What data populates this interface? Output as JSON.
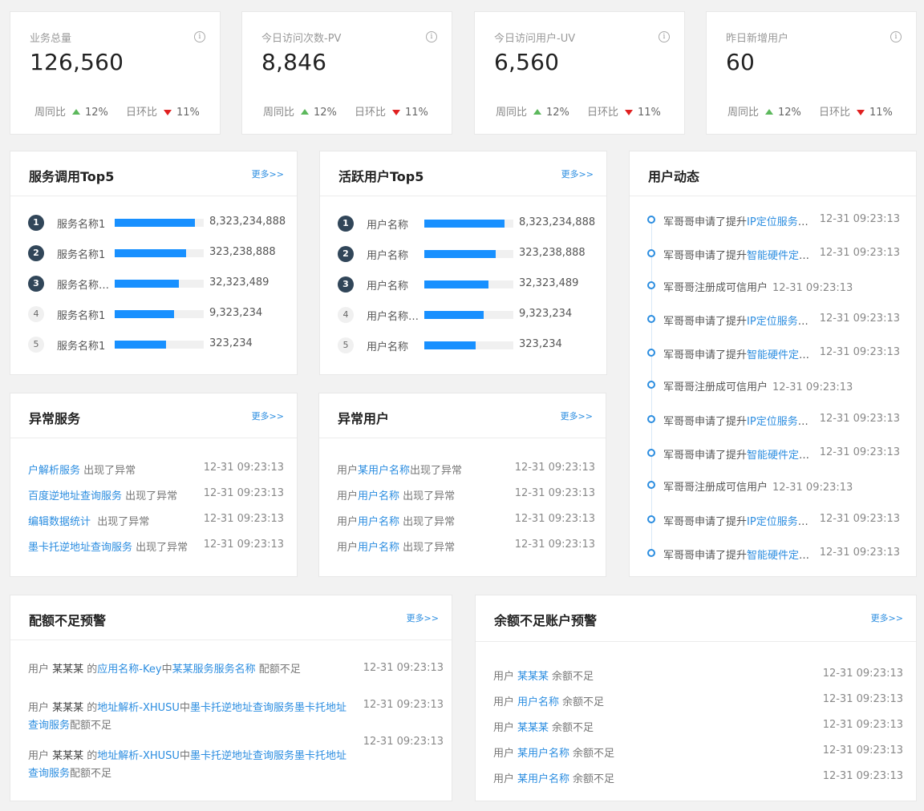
{
  "stats": [
    {
      "title": "业务总量",
      "value": "126,560",
      "week_label": "周同比",
      "week_pct": "12%",
      "day_label": "日环比",
      "day_pct": "11%"
    },
    {
      "title": "今日访问次数-PV",
      "value": "8,846",
      "week_label": "周同比",
      "week_pct": "12%",
      "day_label": "日环比",
      "day_pct": "11%"
    },
    {
      "title": "今日访问用户-UV",
      "value": "6,560",
      "week_label": "周同比",
      "week_pct": "12%",
      "day_label": "日环比",
      "day_pct": "11%"
    },
    {
      "title": "昨日新增用户",
      "value": "60",
      "week_label": "周同比",
      "week_pct": "12%",
      "day_label": "日环比",
      "day_pct": "11%"
    }
  ],
  "info_glyph": "i",
  "more_label": "更多>>",
  "service_top5": {
    "title": "服务调用Top5",
    "items": [
      {
        "rank": "1",
        "name": "服务名称1",
        "value": "8,323,234,888",
        "fill": 0.9
      },
      {
        "rank": "2",
        "name": "服务名称1",
        "value": "323,238,888",
        "fill": 0.8
      },
      {
        "rank": "3",
        "name": "服务名称服务名称",
        "value": "32,323,489",
        "fill": 0.72
      },
      {
        "rank": "4",
        "name": "服务名称1",
        "value": "9,323,234",
        "fill": 0.67
      },
      {
        "rank": "5",
        "name": "服务名称1",
        "value": "323,234",
        "fill": 0.58
      }
    ]
  },
  "user_top5": {
    "title": "活跃用户Top5",
    "items": [
      {
        "rank": "1",
        "name": "用户名称",
        "value": "8,323,234,888",
        "fill": 0.9
      },
      {
        "rank": "2",
        "name": "用户名称",
        "value": "323,238,888",
        "fill": 0.8
      },
      {
        "rank": "3",
        "name": "用户名称",
        "value": "32,323,489",
        "fill": 0.72
      },
      {
        "rank": "4",
        "name": "用户名称用户",
        "value": "9,323,234",
        "fill": 0.67
      },
      {
        "rank": "5",
        "name": "用户名称",
        "value": "323,234",
        "fill": 0.58
      }
    ]
  },
  "user_activity": {
    "title": "用户动态",
    "items": [
      {
        "prefix": "军哥哥申请了提升",
        "link": "IP定位服务服务",
        "time": "12-31 09:23:13"
      },
      {
        "prefix": "军哥哥申请了提升",
        "link": "智能硬件定位服务",
        "time": "12-31 09:23:13"
      },
      {
        "prefix": "军哥哥注册成可信用户",
        "link": "",
        "time": "12-31 09:23:13"
      },
      {
        "prefix": "军哥哥申请了提升",
        "link": "IP定位服务服务",
        "time": "12-31 09:23:13"
      },
      {
        "prefix": "军哥哥申请了提升",
        "link": "智能硬件定位服务",
        "time": "12-31 09:23:13"
      },
      {
        "prefix": "军哥哥注册成可信用户",
        "link": "",
        "time": "12-31 09:23:13"
      },
      {
        "prefix": "军哥哥申请了提升",
        "link": "IP定位服务服务",
        "time": "12-31 09:23:13"
      },
      {
        "prefix": "军哥哥申请了提升",
        "link": "智能硬件定位服务",
        "time": "12-31 09:23:13"
      },
      {
        "prefix": "军哥哥注册成可信用户",
        "link": "",
        "time": "12-31 09:23:13"
      },
      {
        "prefix": "军哥哥申请了提升",
        "link": "IP定位服务服务",
        "time": "12-31 09:23:13"
      },
      {
        "prefix": "军哥哥申请了提升",
        "link": "智能硬件定位服务",
        "time": "12-31 09:23:13"
      }
    ]
  },
  "abnormal_services": {
    "title": "异常服务",
    "items": [
      {
        "link": "户解析服务",
        "suffix": " 出现了异常",
        "time": "12-31 09:23:13"
      },
      {
        "link": "百度逆地址查询服务",
        "suffix": " 出现了异常",
        "time": "12-31 09:23:13"
      },
      {
        "link": "编辑数据统计",
        "suffix": "  出现了异常",
        "time": "12-31 09:23:13"
      },
      {
        "link": "墨卡托逆地址查询服务",
        "suffix": " 出现了异常",
        "time": "12-31 09:23:13"
      }
    ]
  },
  "abnormal_users": {
    "title": "异常用户",
    "items": [
      {
        "prefix": "用户",
        "link": "某用户名称",
        "suffix": "出现了异常",
        "time": "12-31 09:23:13"
      },
      {
        "prefix": "用户",
        "link": "用户名称",
        "suffix": " 出现了异常",
        "time": "12-31 09:23:13"
      },
      {
        "prefix": "用户",
        "link": "用户名称",
        "suffix": " 出现了异常",
        "time": "12-31 09:23:13"
      },
      {
        "prefix": "用户",
        "link": "用户名称",
        "suffix": " 出现了异常",
        "time": "12-31 09:23:13"
      }
    ]
  },
  "quota_warning": {
    "title": "配额不足预警",
    "items": [
      {
        "prefix": "用户 ",
        "user": "某某某",
        "mid": " 的",
        "app": "应用名称-Key",
        "in": "中",
        "service": "某某服务服务名称",
        "suffix": " 配额不足",
        "time": "12-31 09:23:13"
      },
      {
        "prefix": "用户 ",
        "user": "某某某",
        "mid": " 的",
        "app": "地址解析-XHUSU",
        "in": "中",
        "service": "墨卡托逆地址查询服务墨卡托地址查询服务",
        "suffix": "配额不足",
        "time": "12-31 09:23:13"
      },
      {
        "prefix": "用户 ",
        "user": "某某某",
        "mid": " 的",
        "app": "地址解析-XHUSU",
        "in": "中",
        "service": "墨卡托逆地址查询服务墨卡托地址查询服务",
        "suffix": "配额不足",
        "time": "12-31 09:23:13"
      }
    ]
  },
  "balance_warning": {
    "title": "余额不足账户预警",
    "items": [
      {
        "prefix": "用户",
        "user": "某某某",
        "suffix": "余额不足",
        "time": "12-31 09:23:13"
      },
      {
        "prefix": "用户",
        "user": "用户名称",
        "suffix": "余额不足",
        "time": "12-31 09:23:13"
      },
      {
        "prefix": "用户",
        "user": "某某某",
        "suffix": "余额不足",
        "time": "12-31 09:23:13"
      },
      {
        "prefix": "用户",
        "user": "某用户名称",
        "suffix": "余额不足",
        "time": "12-31 09:23:13"
      },
      {
        "prefix": "用户",
        "user": "某用户名称",
        "suffix": "余额不足",
        "time": "12-31 09:23:13"
      }
    ]
  },
  "colors": {
    "accent": "#1890ff",
    "link": "#2b8de0",
    "up": "#5cb85c",
    "down": "#e02020",
    "badge_dark": "#314659"
  }
}
